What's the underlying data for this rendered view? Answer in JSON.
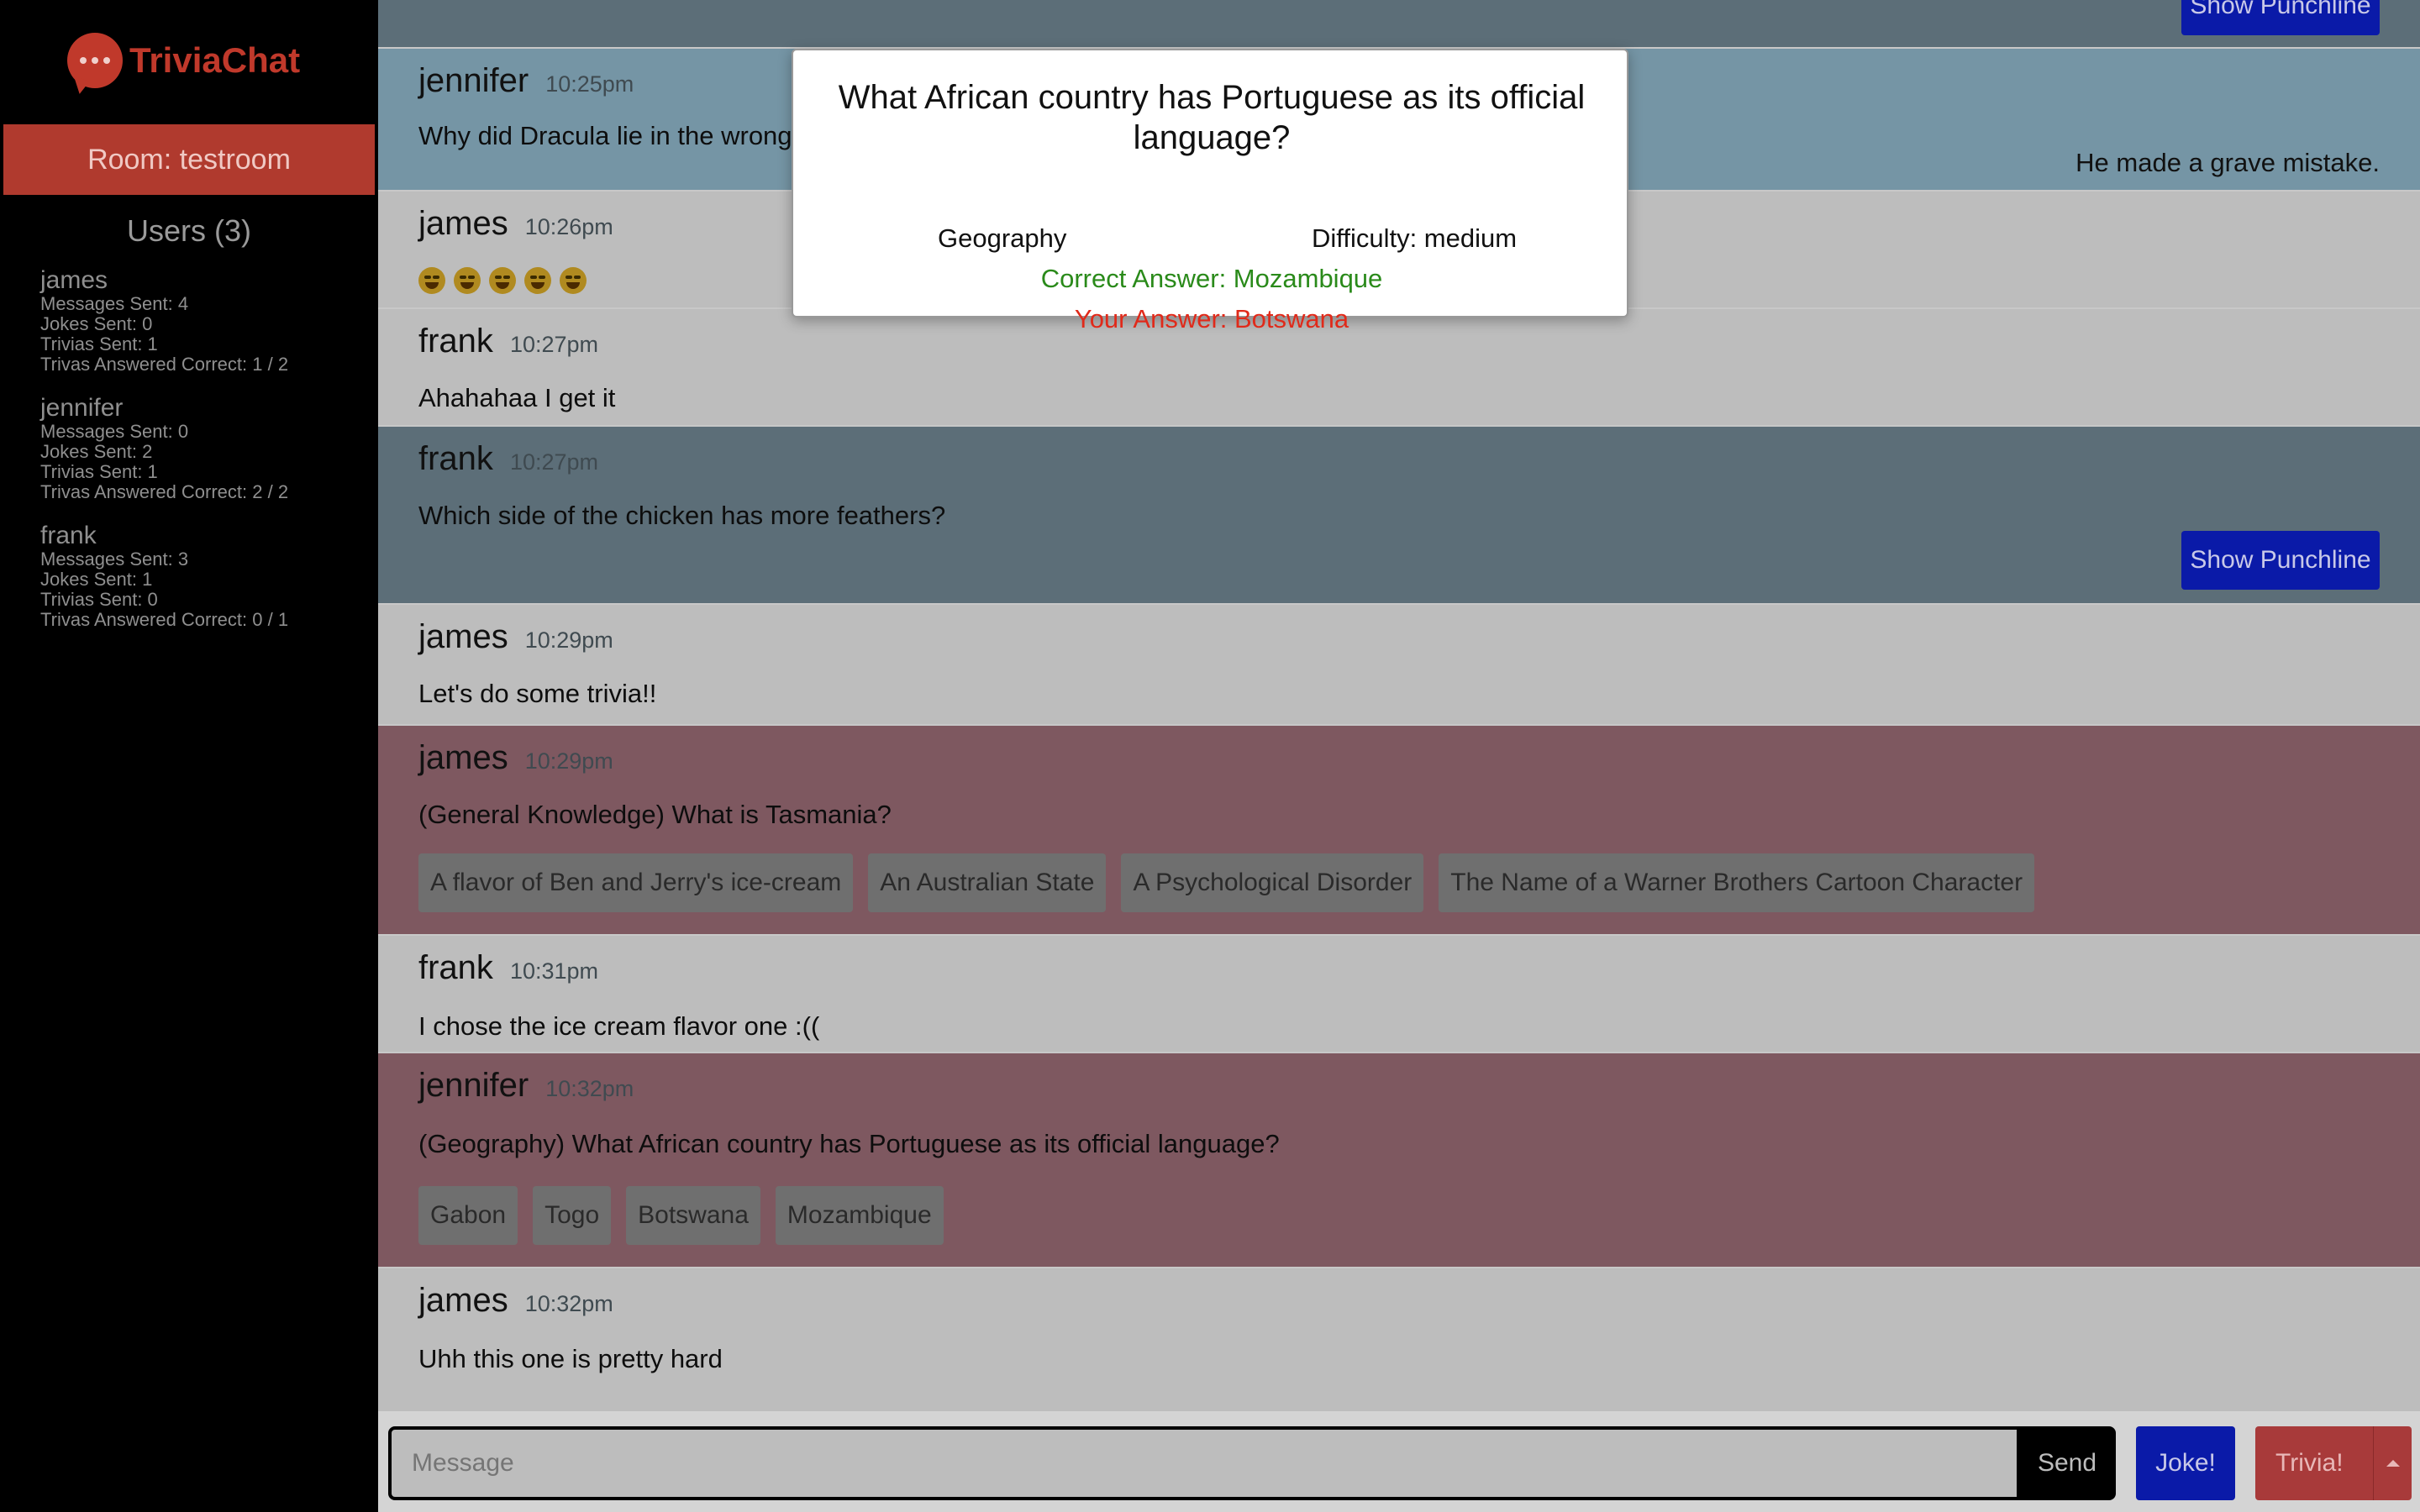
{
  "app": {
    "brand": "TriviaChat"
  },
  "sidebar": {
    "room_label": "Room: testroom",
    "users_title": "Users (3)",
    "users": [
      {
        "name": "james",
        "stats": [
          "Messages Sent: 4",
          "Jokes Sent: 0",
          "Trivias Sent: 1",
          "Trivas Answered Correct: 1 / 2"
        ]
      },
      {
        "name": "jennifer",
        "stats": [
          "Messages Sent: 0",
          "Jokes Sent: 2",
          "Trivias Sent: 1",
          "Trivas Answered Correct: 2 / 2"
        ]
      },
      {
        "name": "frank",
        "stats": [
          "Messages Sent: 3",
          "Jokes Sent: 1",
          "Trivias Sent: 0",
          "Trivas Answered Correct: 0 / 1"
        ]
      }
    ]
  },
  "chat": {
    "top_partial_button": "Show Punchline",
    "messages": [
      {
        "author": "jennifer",
        "time": "10:25pm",
        "text": "Why did Dracula lie in the wrong",
        "punchline": "He made a grave mistake."
      },
      {
        "author": "james",
        "time": "10:26pm",
        "emoji_count": 5
      },
      {
        "author": "frank",
        "time": "10:27pm",
        "text": "Ahahahaa I get it"
      },
      {
        "author": "frank",
        "time": "10:27pm",
        "text": "Which side of the chicken has more feathers?",
        "button": "Show Punchline"
      },
      {
        "author": "james",
        "time": "10:29pm",
        "text": "Let's do some trivia!!"
      },
      {
        "author": "james",
        "time": "10:29pm",
        "text": "(General Knowledge) What is Tasmania?",
        "options": [
          "A flavor of Ben and Jerry's ice-cream",
          "An Australian State",
          "A Psychological Disorder",
          "The Name of a Warner Brothers Cartoon Character"
        ]
      },
      {
        "author": "frank",
        "time": "10:31pm",
        "text": "I chose the ice cream flavor one :(("
      },
      {
        "author": "jennifer",
        "time": "10:32pm",
        "text": "(Geography) What African country has Portuguese as its official language?",
        "options": [
          "Gabon",
          "Togo",
          "Botswana",
          "Mozambique"
        ]
      },
      {
        "author": "james",
        "time": "10:32pm",
        "text": "Uhh this one is pretty hard"
      }
    ]
  },
  "composer": {
    "placeholder": "Message",
    "send_label": "Send",
    "joke_label": "Joke!",
    "trivia_label": "Trivia!"
  },
  "modal": {
    "question": "What African country has Portuguese as its official language?",
    "category": "Geography",
    "difficulty": "Difficulty: medium",
    "correct": "Correct Answer: Mozambique",
    "yours": "Your Answer: Botswana"
  },
  "colors": {
    "brand": "#c0392b",
    "room_bg": "#b03a2e",
    "joke_bg": "#5c6e78",
    "trivia_bg": "#7e5860",
    "button_blue": "#0a1aa8",
    "correct": "#2a8a1a",
    "wrong": "#e02a1a"
  }
}
